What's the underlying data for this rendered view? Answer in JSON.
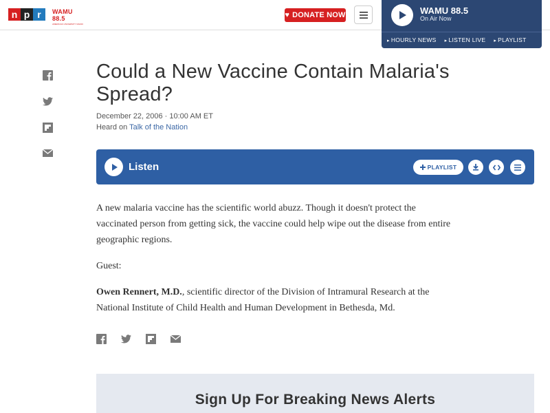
{
  "header": {
    "logo_letters": [
      "n",
      "p",
      "r"
    ],
    "station_logo_text": "WAMU 88.5",
    "station_logo_tagline": "AMERICAN UNIVERSITY RADIO",
    "donate_label": "DONATE NOW",
    "menu_icon": "hamburger-icon",
    "brand_colors": {
      "npr_n": "#d62021",
      "npr_p": "#222222",
      "npr_r": "#237bbd",
      "donate": "#d62021"
    }
  },
  "player": {
    "station": "WAMU 88.5",
    "status": "On Air Now",
    "links": [
      "HOURLY NEWS",
      "LISTEN LIVE",
      "PLAYLIST"
    ],
    "background": "#2c4773"
  },
  "side_share": [
    "facebook-icon",
    "twitter-icon",
    "flipboard-icon",
    "email-icon"
  ],
  "article": {
    "title": "Could a New Vaccine Contain Malaria's Spread?",
    "date": "December 22, 2006 · 10:00 AM ET",
    "heard_prefix": "Heard on ",
    "heard_program": "Talk of the Nation",
    "listen": {
      "label": "Listen",
      "playlist_label": "PLAYLIST",
      "icons": [
        "play-icon",
        "plus-icon",
        "download-icon",
        "embed-icon",
        "transcript-icon"
      ],
      "background": "#2e5fa4"
    },
    "paragraph1": "A new malaria vaccine has the scientific world abuzz. Though it doesn't protect the vaccinated person from getting sick, the vaccine could help wipe out the disease from entire geographic regions.",
    "paragraph2": "Guest:",
    "guest_name": "Owen Rennert, M.D.",
    "guest_description": ", scientific director of the Division of Intramural Research at the National Institute of Child Health and Human Development in Bethesda, Md."
  },
  "bottom_share": [
    "facebook-icon",
    "twitter-icon",
    "flipboard-icon",
    "email-icon"
  ],
  "alerts": {
    "heading": "Sign Up For Breaking News Alerts"
  }
}
